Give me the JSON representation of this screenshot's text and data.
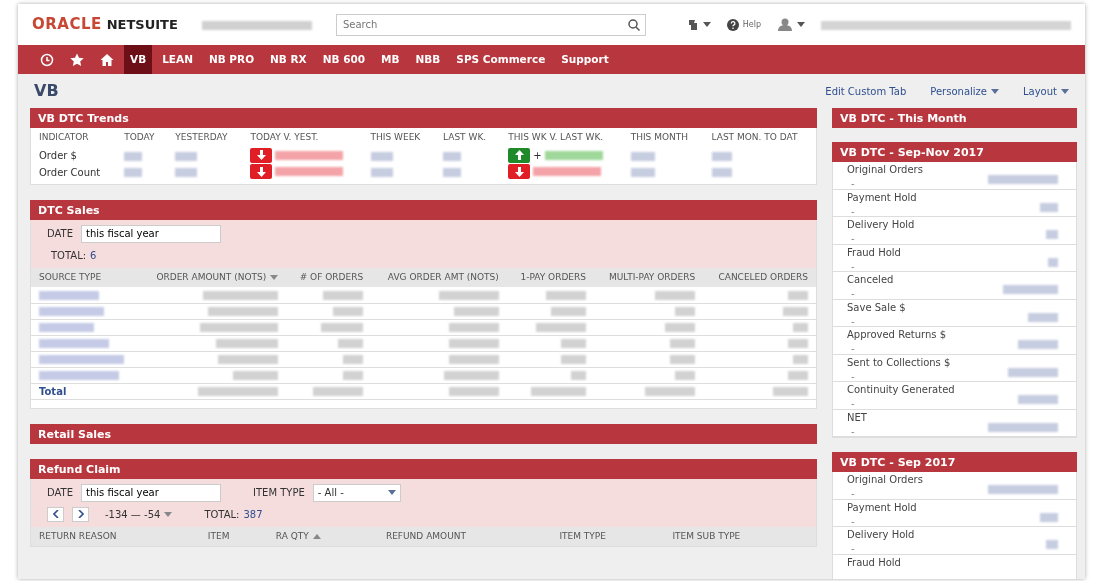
{
  "header": {
    "logo_primary": "ORACLE",
    "logo_secondary": "NETSUITE",
    "search": {
      "placeholder": "Search"
    },
    "help": "Help"
  },
  "nav": [
    {
      "kind": "history",
      "selected": false
    },
    {
      "kind": "favorites",
      "selected": false
    },
    {
      "kind": "home",
      "selected": false
    },
    {
      "kind": "tab",
      "label": "VB",
      "selected": true
    },
    {
      "kind": "tab",
      "label": "LEAN",
      "selected": false
    },
    {
      "kind": "tab",
      "label": "NB PRO",
      "selected": false
    },
    {
      "kind": "tab",
      "label": "NB RX",
      "selected": false
    },
    {
      "kind": "tab",
      "label": "NB 600",
      "selected": false
    },
    {
      "kind": "tab",
      "label": "MB",
      "selected": false
    },
    {
      "kind": "tab",
      "label": "NBB",
      "selected": false
    },
    {
      "kind": "tab",
      "label": "SPS Commerce",
      "selected": false
    },
    {
      "kind": "tab",
      "label": "Support",
      "selected": false
    }
  ],
  "page": {
    "title": "VB",
    "actions": [
      {
        "label": "Edit Custom Tab",
        "dropdown": false
      },
      {
        "label": "Personalize",
        "dropdown": true
      },
      {
        "label": "Layout",
        "dropdown": true
      }
    ]
  },
  "trends": {
    "title": "VB DTC Trends",
    "columns": [
      "INDICATOR",
      "TODAY",
      "YESTERDAY",
      "TODAY V. YEST.",
      "THIS WEEK",
      "LAST WK.",
      "THIS WK V. LAST WK.",
      "THIS MONTH",
      "LAST MON. TO DAT"
    ],
    "rows": [
      {
        "label": "Order $",
        "today_v_yest_up": false,
        "wk_v_last_wk_up": true,
        "wk_prefix": "+"
      },
      {
        "label": "Order Count",
        "today_v_yest_up": false,
        "wk_v_last_wk_up": false
      }
    ]
  },
  "dtc_sales": {
    "title": "DTC Sales",
    "date_label": "DATE",
    "date_value": "this fiscal year",
    "total_label": "TOTAL:",
    "total_value": "6",
    "columns": [
      {
        "label": "SOURCE TYPE",
        "sorted": false
      },
      {
        "label": "ORDER AMOUNT (NOTS)",
        "sorted": true,
        "descending": true
      },
      {
        "label": "# OF ORDERS",
        "sorted": false
      },
      {
        "label": "AVG ORDER AMT (NOTS)",
        "sorted": false
      },
      {
        "label": "1-PAY ORDERS",
        "sorted": false
      },
      {
        "label": "MULTI-PAY ORDERS",
        "sorted": false
      },
      {
        "label": "CANCELED ORDERS",
        "sorted": false
      }
    ],
    "rows": [
      {
        "kind": "data"
      },
      {
        "kind": "data"
      },
      {
        "kind": "data"
      },
      {
        "kind": "data"
      },
      {
        "kind": "data"
      },
      {
        "kind": "data"
      },
      {
        "kind": "total",
        "label": "Total"
      }
    ]
  },
  "retail_sales": {
    "title": "Retail Sales"
  },
  "refund_claim": {
    "title": "Refund Claim",
    "date_label": "DATE",
    "date_value": "this fiscal year",
    "item_type_label": "ITEM TYPE",
    "item_type_value": "- All -",
    "range": "-134 — -54",
    "total_label": "TOTAL:",
    "total_value": "387",
    "columns": [
      {
        "label": "RETURN REASON",
        "sorted": false
      },
      {
        "label": "ITEM",
        "sorted": false
      },
      {
        "label": "RA QTY",
        "sorted": true,
        "descending": false
      },
      {
        "label": "REFUND AMOUNT",
        "sorted": false
      },
      {
        "label": "ITEM TYPE",
        "sorted": false
      },
      {
        "label": "ITEM SUB TYPE",
        "sorted": false
      }
    ]
  },
  "sidebar": [
    {
      "title": "VB DTC - This Month"
    },
    {
      "title": "VB DTC - Sep-Nov 2017",
      "items": [
        {
          "label": "Original Orders",
          "sub": "-"
        },
        {
          "label": "Payment Hold",
          "sub": "-"
        },
        {
          "label": "Delivery Hold",
          "sub": "-"
        },
        {
          "label": "Fraud Hold",
          "sub": "-"
        },
        {
          "label": "Canceled",
          "sub": "-"
        },
        {
          "label": "Save Sale $",
          "sub": "-"
        },
        {
          "label": "Approved Returns $",
          "sub": "-"
        },
        {
          "label": "Sent to Collections $",
          "sub": "-"
        },
        {
          "label": "Continuity Generated",
          "sub": "-"
        },
        {
          "label": "NET",
          "sub": "-"
        }
      ]
    },
    {
      "title": "VB DTC - Sep 2017",
      "items": [
        {
          "label": "Original Orders",
          "sub": "-"
        },
        {
          "label": "Payment Hold",
          "sub": "-"
        },
        {
          "label": "Delivery Hold",
          "sub": "-"
        },
        {
          "label": "Fraud Hold"
        }
      ]
    }
  ]
}
